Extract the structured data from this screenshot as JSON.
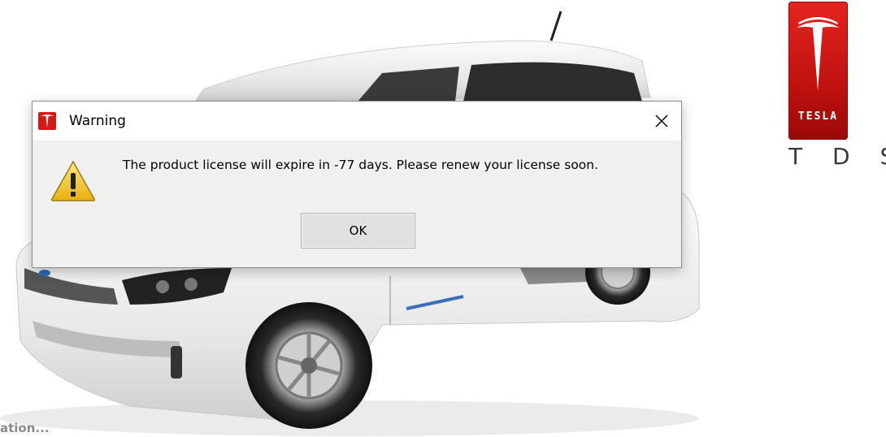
{
  "splash": {
    "brand_wordmark": "TESLA",
    "product_name": "T D S",
    "status_text": "ation..."
  },
  "dialog": {
    "title": "Warning",
    "title_icon": "tesla-logo-icon",
    "message": "The product license will expire in -77 days. Please renew your license soon.",
    "message_icon": "warning-triangle-icon",
    "ok_label": "OK",
    "close_icon": "close-icon"
  },
  "colors": {
    "tesla_red": "#e42420",
    "dialog_bg": "#f0f0f0",
    "button_bg": "#e1e1e1",
    "warning_yellow": "#f5c518"
  }
}
